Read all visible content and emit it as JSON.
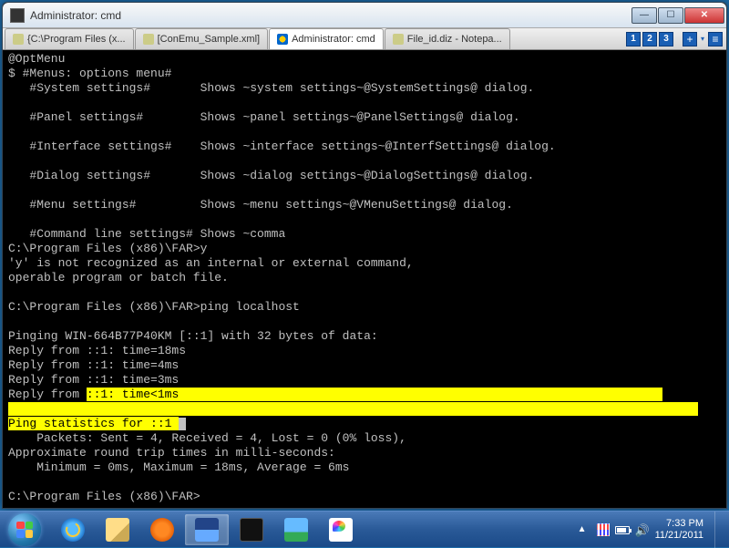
{
  "window": {
    "title": "Administrator: cmd"
  },
  "tabs": [
    {
      "label": "{C:\\Program Files (x...",
      "active": false
    },
    {
      "label": "[ConEmu_Sample.xml]",
      "active": false
    },
    {
      "label": "Administrator: cmd",
      "active": true,
      "shield": true
    },
    {
      "label": "File_id.diz - Notepa...",
      "active": false
    }
  ],
  "tabctrls": {
    "nums": [
      "1",
      "2",
      "3"
    ],
    "plus": "+"
  },
  "terminal": {
    "lines": [
      "@OptMenu",
      "$ #Menus: options menu#",
      "   #System settings#       Shows ~system settings~@SystemSettings@ dialog.",
      "",
      "   #Panel settings#        Shows ~panel settings~@PanelSettings@ dialog.",
      "",
      "   #Interface settings#    Shows ~interface settings~@InterfSettings@ dialog.",
      "",
      "   #Dialog settings#       Shows ~dialog settings~@DialogSettings@ dialog.",
      "",
      "   #Menu settings#         Shows ~menu settings~@VMenuSettings@ dialog.",
      "",
      "   #Command line settings# Shows ~comma",
      "C:\\Program Files (x86)\\FAR>y",
      "'y' is not recognized as an internal or external command,",
      "operable program or batch file.",
      "",
      "C:\\Program Files (x86)\\FAR>ping localhost",
      "",
      "Pinging WIN-664B77P40KM [::1] with 32 bytes of data:",
      "Reply from ::1: time=18ms",
      "Reply from ::1: time=4ms",
      "Reply from ::1: time=3ms"
    ],
    "hl1_pre": "Reply from ",
    "hl1_hl": "::1: time<1ms",
    "hl2_hl": "Ping statistics for ::1",
    "after": [
      "    Packets: Sent = 4, Received = 4, Lost = 0 (0% loss),",
      "Approximate round trip times in milli-seconds:",
      "    Minimum = 0ms, Maximum = 18ms, Average = 6ms",
      "",
      "C:\\Program Files (x86)\\FAR>"
    ]
  },
  "tray": {
    "time": "7:33 PM",
    "date": "11/21/2011"
  }
}
